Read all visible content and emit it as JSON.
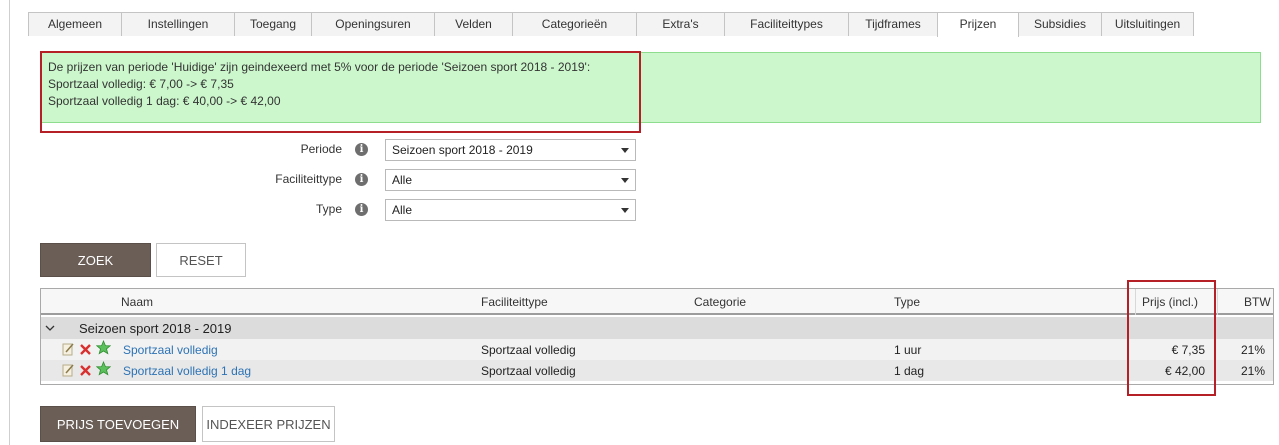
{
  "tabs": [
    "Algemeen",
    "Instellingen",
    "Toegang",
    "Openingsuren",
    "Velden",
    "Categorieën",
    "Extra's",
    "Faciliteittypes",
    "Tijdframes",
    "Prijzen",
    "Subsidies",
    "Uitsluitingen"
  ],
  "active_tab": "Prijzen",
  "message": {
    "line1": "De prijzen van periode 'Huidige' zijn geindexeerd met 5% voor de periode 'Seizoen sport 2018 - 2019':",
    "line2": "Sportzaal volledig: € 7,00 -> € 7,35",
    "line3": "Sportzaal volledig 1 dag: € 40,00 -> € 42,00"
  },
  "filters": {
    "periode_label": "Periode",
    "periode_value": "Seizoen sport 2018 - 2019",
    "faciliteittype_label": "Faciliteittype",
    "faciliteittype_value": "Alle",
    "type_label": "Type",
    "type_value": "Alle"
  },
  "buttons": {
    "zoek": "ZOEK",
    "reset": "RESET",
    "prijs_toevoegen": "PRIJS TOEVOEGEN",
    "indexeer_prijzen": "INDEXEER PRIJZEN"
  },
  "table": {
    "headers": {
      "naam": "Naam",
      "faciliteittype": "Faciliteittype",
      "categorie": "Categorie",
      "type": "Type",
      "prijs": "Prijs (incl.)",
      "btw": "BTW"
    },
    "group": "Seizoen sport 2018 - 2019",
    "rows": [
      {
        "naam": "Sportzaal volledig",
        "faciliteittype": "Sportzaal volledig",
        "categorie": "",
        "type": "1 uur",
        "prijs": "€ 7,35",
        "btw": "21%"
      },
      {
        "naam": "Sportzaal volledig 1 dag",
        "faciliteittype": "Sportzaal volledig",
        "categorie": "",
        "type": "1 dag",
        "prijs": "€ 42,00",
        "btw": "21%"
      }
    ]
  },
  "colors": {
    "success_bg": "#ccf7cc",
    "highlight": "#b52026",
    "primary_button": "#6b5e57",
    "link": "#2d73b5"
  }
}
